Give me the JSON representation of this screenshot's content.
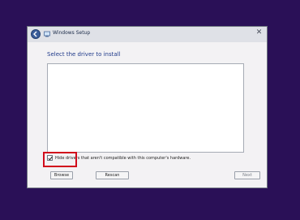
{
  "window": {
    "title": "Windows Setup",
    "close_glyph": "✕",
    "icons": {
      "back": "back-arrow-icon",
      "app": "windows-setup-icon",
      "close": "close-icon"
    }
  },
  "main": {
    "heading": "Select the driver to install",
    "driver_list": [],
    "hide_incompatible": {
      "label": "Hide drivers that aren't compatible with this computer's hardware.",
      "checked": true
    }
  },
  "buttons": {
    "browse": "Browse",
    "rescan": "Rescan",
    "next": "Next"
  },
  "colors": {
    "desktop": "#2a1057",
    "heading": "#1f3a8a",
    "highlight": "#d10c1c"
  }
}
